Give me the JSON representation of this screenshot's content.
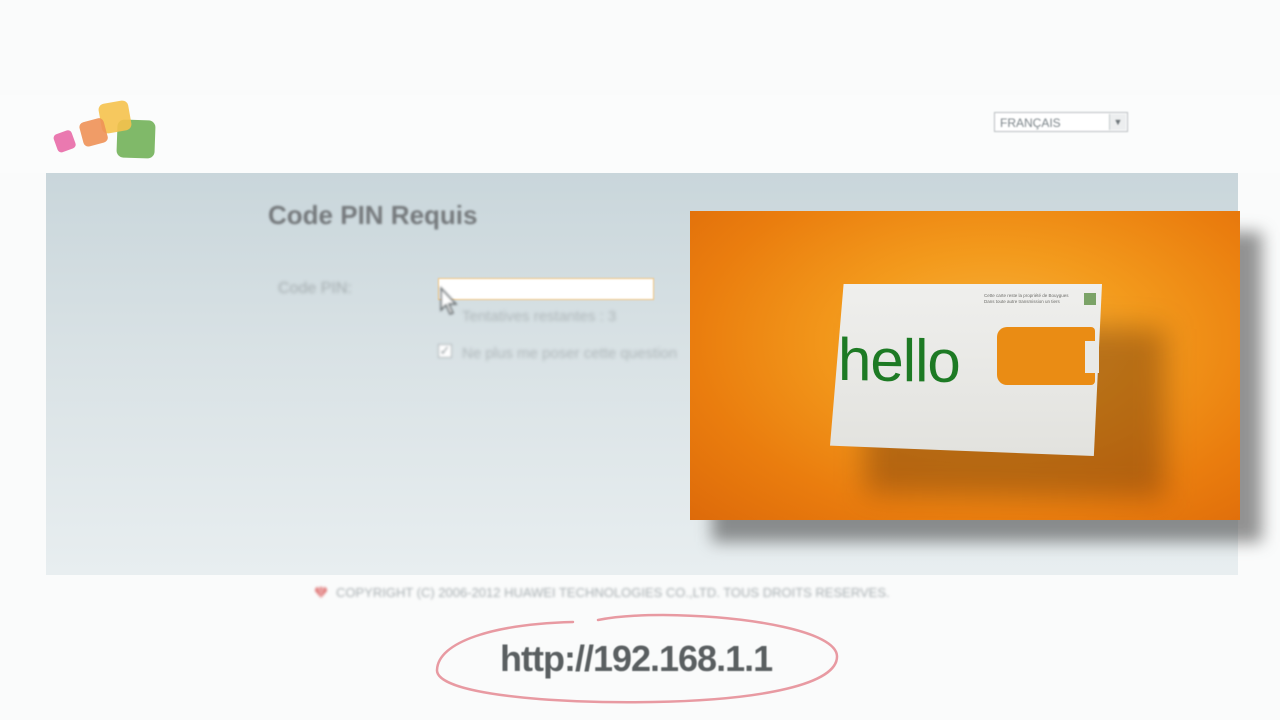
{
  "header": {
    "logo_icon": "colored-squares-logo",
    "language": {
      "selected": "FRANÇAIS",
      "arrow_icon": "chevron-down-icon"
    }
  },
  "pin_form": {
    "title": "Code PIN Requis",
    "pin_label": "Code PIN:",
    "pin_value": "",
    "attempts_text": "Tentatives restantes : 3",
    "remember_checked": true,
    "remember_label": "Ne plus me poser cette question"
  },
  "promo": {
    "sim_brand_text": "hello",
    "sim_fine_print": [
      "Cette carte reste la propriété de Bouygues",
      "Dans toute autre transmission un tiers"
    ],
    "background_color": "#f39a1c",
    "brand_color": "#1d7a24"
  },
  "footer": {
    "brand_icon": "huawei-logo-icon",
    "copyright": "COPYRIGHT (C) 2006-2012 HUAWEI TECHNOLOGIES CO.,LTD. TOUS DROITS RESERVES."
  },
  "overlay": {
    "url": "http://192.168.1.1",
    "circle_color": "#e89aa2"
  }
}
